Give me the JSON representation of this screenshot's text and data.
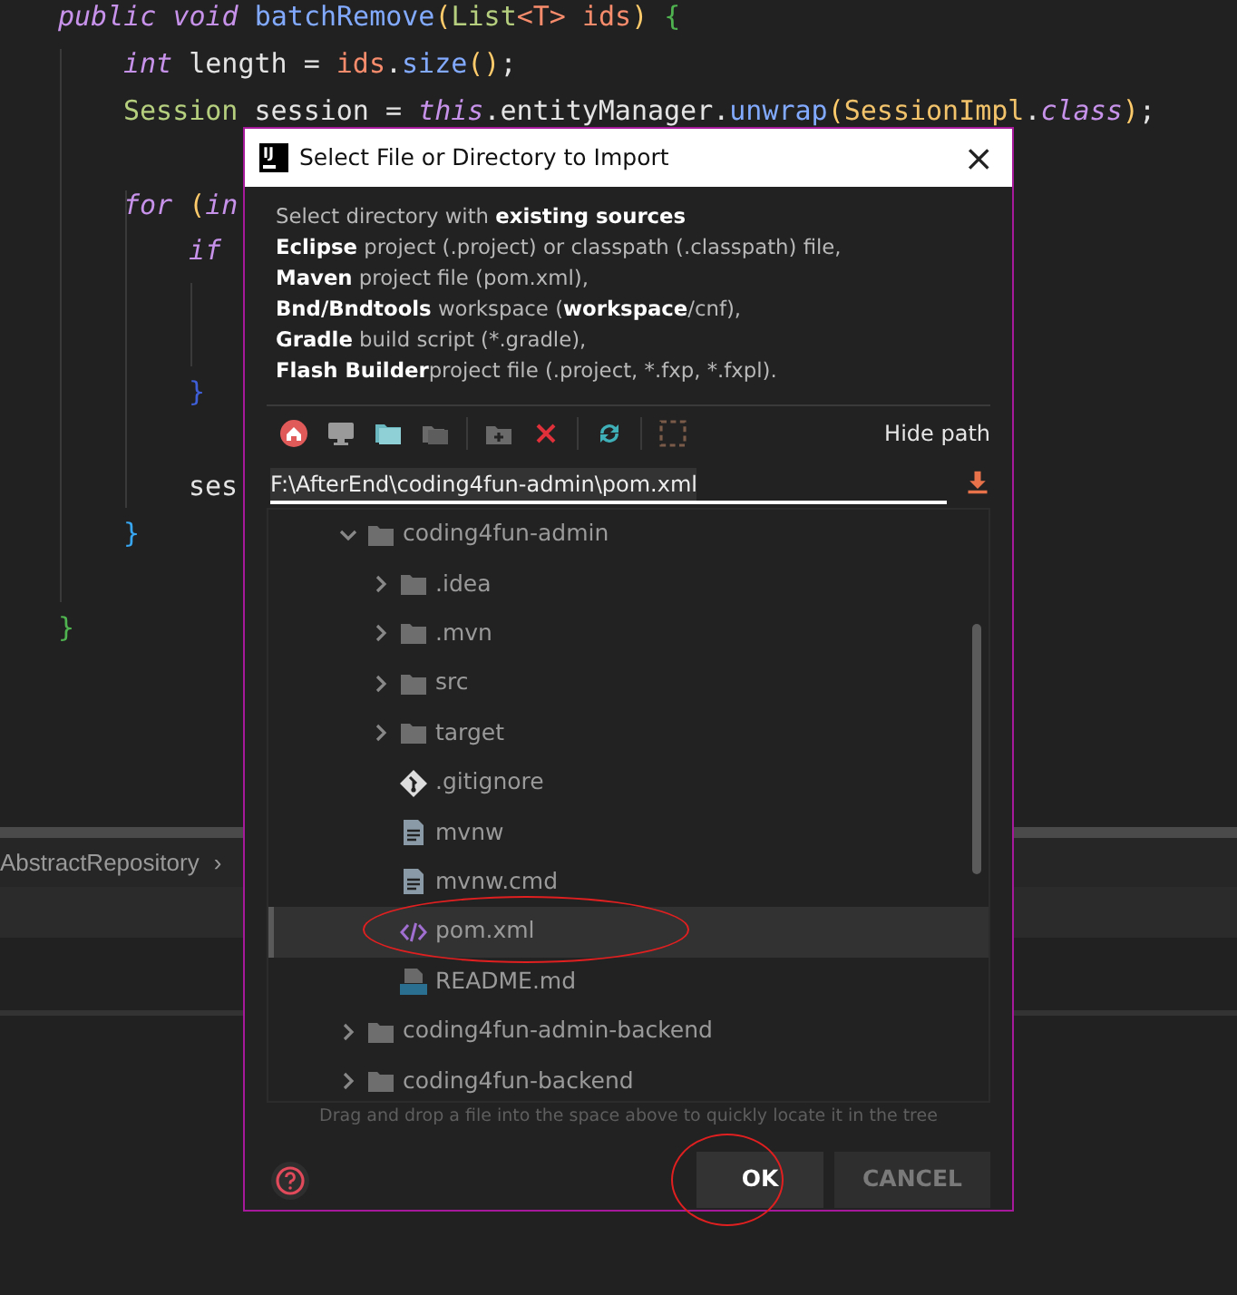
{
  "editor": {
    "lines": [
      {
        "kind": "code",
        "tokens": [
          {
            "text": "public",
            "kind": "keyword"
          },
          {
            "text": " void",
            "kind": "keyword"
          },
          {
            "text": " batchRemove",
            "kind": "method"
          },
          {
            "text": "(",
            "kind": "paren"
          },
          {
            "text": "List",
            "kind": "type"
          },
          {
            "text": "<T>",
            "kind": "param"
          },
          {
            "text": " ids",
            "kind": "param"
          },
          {
            "text": ")",
            "kind": "paren"
          },
          {
            "text": " {",
            "kind": "brace_outer"
          }
        ],
        "children": [
          {
            "kind": "code",
            "tokens": [
              {
                "text": "int",
                "kind": "keyword"
              },
              {
                "text": " length = ",
                "kind": "plain"
              },
              {
                "text": "ids",
                "kind": "param"
              },
              {
                "text": ".",
                "kind": "plain"
              },
              {
                "text": "size",
                "kind": "method"
              },
              {
                "text": "()",
                "kind": "paren"
              },
              {
                "text": ";",
                "kind": "plain"
              }
            ]
          },
          {
            "kind": "code",
            "tokens": [
              {
                "text": "Session",
                "kind": "type"
              },
              {
                "text": " session = ",
                "kind": "plain"
              },
              {
                "text": "this",
                "kind": "keyword"
              },
              {
                "text": ".entityManager.",
                "kind": "plain"
              },
              {
                "text": "unwrap",
                "kind": "method"
              },
              {
                "text": "(",
                "kind": "paren"
              },
              {
                "text": "SessionImpl",
                "kind": "classname"
              },
              {
                "text": ".",
                "kind": "plain"
              },
              {
                "text": "class",
                "kind": "keyword"
              },
              {
                "text": ")",
                "kind": "paren"
              },
              {
                "text": ";",
                "kind": "plain"
              }
            ]
          },
          {
            "kind": "blank"
          },
          {
            "kind": "code",
            "tokens": [
              {
                "text": "for",
                "kind": "keyword"
              },
              {
                "text": " (",
                "kind": "paren"
              },
              {
                "text": "in",
                "kind": "keyword"
              }
            ],
            "children": [
              {
                "kind": "code",
                "tokens": [
                  {
                    "text": "if",
                    "kind": "keyword"
                  }
                ],
                "children": [
                  {
                    "kind": "blank"
                  },
                  {
                    "kind": "blank"
                  }
                ]
              },
              {
                "kind": "code",
                "tokens": [
                  {
                    "text": "}",
                    "kind": "brace_inner"
                  }
                ]
              },
              {
                "kind": "blank"
              },
              {
                "kind": "code",
                "tokens": [
                  {
                    "text": "ses",
                    "kind": "plain"
                  }
                ]
              }
            ]
          },
          {
            "kind": "code",
            "tokens": [
              {
                "text": "}",
                "kind": "brace_mid"
              }
            ]
          },
          {
            "kind": "blank"
          }
        ]
      },
      {
        "kind": "code",
        "tokens": [
          {
            "text": "}",
            "kind": "brace_outer"
          }
        ]
      }
    ]
  },
  "breadcrumb": {
    "label": "AbstractRepository",
    "separator": "›"
  },
  "dialog": {
    "logo": "IJ",
    "title": "Select File or Directory to Import",
    "close": "×",
    "description": [
      "Select directory with  **existing sources**",
      "**Eclipse** project (.project) or classpath (.classpath) file,",
      "**Maven**  project file (pom.xml),",
      "**Bnd/Bndtools** workspace (**workspace**/cnf),",
      "**Gradle** build script (*.gradle),",
      "**Flash Builder**project file (.project, *.fxp, *.fxpl)."
    ],
    "hide_path": "Hide path",
    "path": "F:\\AfterEnd\\coding4fun-admin\\pom.xml",
    "tree": [
      {
        "label": "coding4fun-admin",
        "kind": "folder",
        "expanded": true,
        "selected": false,
        "circled": false,
        "children": [
          {
            "label": ".idea",
            "kind": "folder",
            "expanded": false,
            "selected": false,
            "circled": false
          },
          {
            "label": ".mvn",
            "kind": "folder",
            "expanded": false,
            "selected": false,
            "circled": false
          },
          {
            "label": "src",
            "kind": "folder",
            "expanded": false,
            "selected": false,
            "circled": false
          },
          {
            "label": "target",
            "kind": "folder",
            "expanded": false,
            "selected": false,
            "circled": false
          },
          {
            "label": ".gitignore",
            "kind": "git",
            "selected": false,
            "circled": false
          },
          {
            "label": "mvnw",
            "kind": "text",
            "selected": false,
            "circled": false
          },
          {
            "label": "mvnw.cmd",
            "kind": "text",
            "selected": false,
            "circled": false
          },
          {
            "label": "pom.xml",
            "kind": "xml",
            "selected": true,
            "circled": true
          },
          {
            "label": "README.md",
            "kind": "markdown",
            "selected": false,
            "circled": false
          }
        ]
      },
      {
        "label": "coding4fun-admin-backend",
        "kind": "folder",
        "expanded": false,
        "selected": false,
        "circled": false
      },
      {
        "label": "coding4fun-backend",
        "kind": "folder",
        "expanded": false,
        "selected": false,
        "circled": false
      }
    ],
    "hint": "Drag and drop a file into the space above to quickly locate it in the tree",
    "buttons": [
      {
        "label": "OK",
        "kind": "primary",
        "circled": true
      },
      {
        "label": "CANCEL",
        "kind": "secondary",
        "circled": false
      }
    ]
  }
}
